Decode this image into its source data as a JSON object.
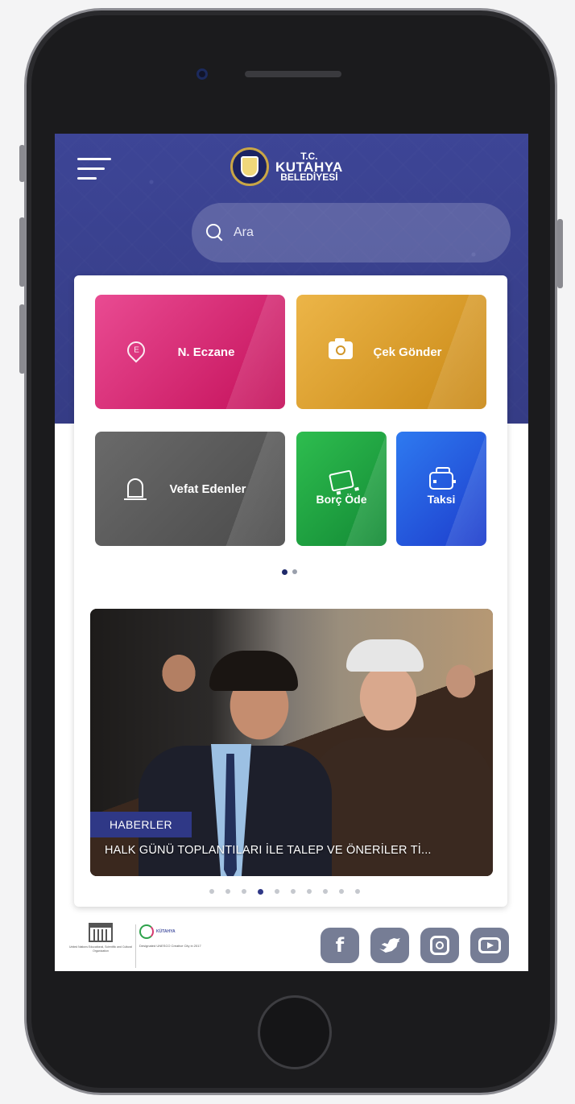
{
  "header": {
    "logo": {
      "line1": "T.C.",
      "line2": "KUTAHYA",
      "line3": "BELEDİYESİ"
    },
    "search": {
      "placeholder": "Ara"
    }
  },
  "quick_actions": [
    {
      "label": "N. Eczane",
      "icon": "pharmacy-pin-icon",
      "color": "#d42a78"
    },
    {
      "label": "Çek Gönder",
      "icon": "camera-icon",
      "color": "#dba133"
    },
    {
      "label": "Vefat Edenler",
      "icon": "tombstone-icon",
      "color": "#5a5a5a"
    },
    {
      "label": "Borç Öde",
      "icon": "truck-icon",
      "color": "#22a843"
    },
    {
      "label": "Taksi",
      "icon": "taxi-icon",
      "color": "#2559df"
    }
  ],
  "quick_actions_pager": {
    "pages": 2,
    "active": 1
  },
  "news_slider": {
    "tag": "HABERLER",
    "title": "HALK GÜNÜ TOPLANTILARI İLE TALEP VE ÖNERİLER Tİ...",
    "pages": 10,
    "active": 4
  },
  "footer": {
    "unesco_text": "United Nations Educational, Scientific and Cultural Organization",
    "creative_city_name": "KÜTAHYA",
    "creative_city_text": "Designated UNESCO Creative City in 2017",
    "social": [
      "facebook-icon",
      "twitter-icon",
      "instagram-icon",
      "youtube-icon"
    ]
  },
  "colors": {
    "header": "#3d4596",
    "accent": "#2f3886",
    "social_bg": "#767d95"
  }
}
